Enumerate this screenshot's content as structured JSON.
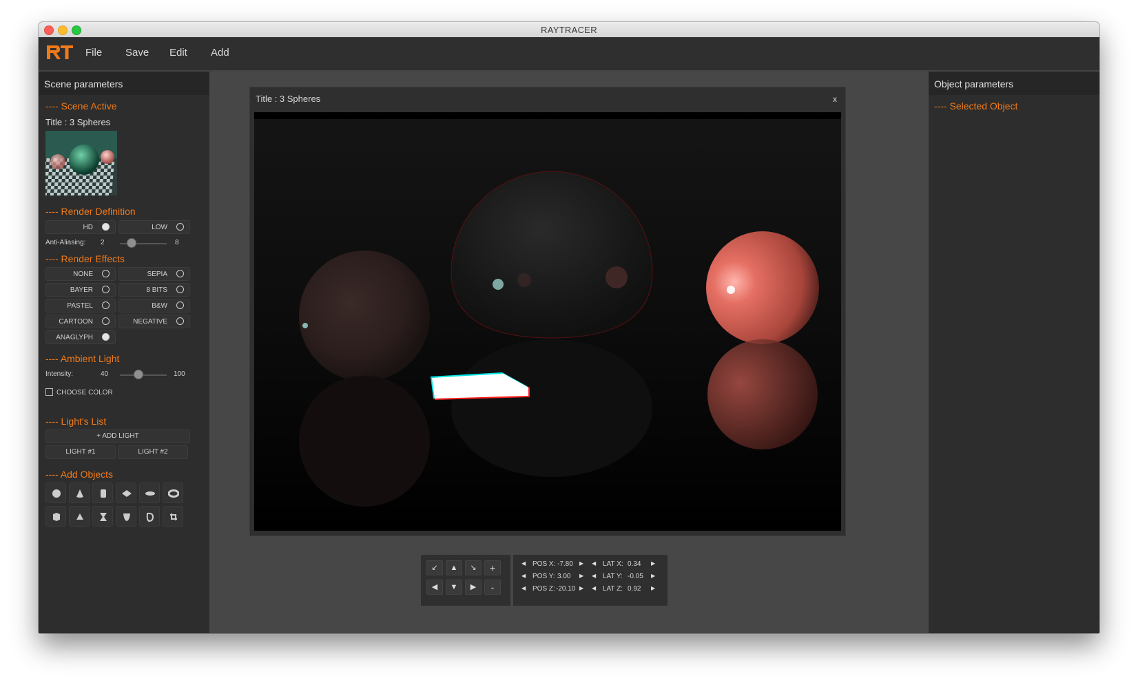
{
  "window": {
    "title": "RAYTRACER"
  },
  "menu": {
    "file": "File",
    "save": "Save",
    "edit": "Edit",
    "add": "Add"
  },
  "colors": {
    "accent": "#ef7a1a",
    "panel": "#2d2d2d",
    "background": "#474747"
  },
  "left_panel": {
    "header": "Scene parameters",
    "scene_active": {
      "heading": "---- Scene Active",
      "title": "Title : 3 Spheres"
    },
    "render_definition": {
      "heading": "---- Render Definition",
      "options": [
        {
          "label": "HD",
          "selected": true
        },
        {
          "label": "LOW",
          "selected": false
        }
      ],
      "anti_aliasing": {
        "label": "Anti-Aliasing:",
        "value": "2",
        "max": "8",
        "fraction": 0.25
      }
    },
    "render_effects": {
      "heading": "---- Render Effects",
      "options": [
        {
          "label": "NONE",
          "selected": false
        },
        {
          "label": "SEPIA",
          "selected": false
        },
        {
          "label": "BAYER",
          "selected": false
        },
        {
          "label": "8 BITS",
          "selected": false
        },
        {
          "label": "PASTEL",
          "selected": false
        },
        {
          "label": "B&W",
          "selected": false
        },
        {
          "label": "CARTOON",
          "selected": false
        },
        {
          "label": "NEGATIVE",
          "selected": false
        },
        {
          "label": "ANAGLYPH",
          "selected": true
        }
      ]
    },
    "ambient_light": {
      "heading": "---- Ambient Light",
      "intensity_label": "Intensity:",
      "value": "40",
      "max": "100",
      "fraction": 0.4,
      "choose_color": "CHOOSE COLOR"
    },
    "lights": {
      "heading": "---- Light's List",
      "add_label": "+ ADD LIGHT",
      "items": [
        "LIGHT #1",
        "LIGHT #2"
      ]
    },
    "add_objects": {
      "heading": "---- Add Objects",
      "icons": [
        "sphere-icon",
        "cone-icon",
        "cylinder-icon",
        "plane-icon",
        "disc-icon",
        "torus-icon",
        "cube-icon",
        "pyramid-icon",
        "hourboloid-icon",
        "paraboloid-icon",
        "mobius-icon",
        "composite-icon"
      ]
    }
  },
  "right_panel": {
    "header": "Object parameters",
    "selected_heading": "---- Selected Object"
  },
  "render_window": {
    "title": "Title : 3 Spheres",
    "close": "x"
  },
  "navigation": {
    "plus": "+",
    "minus": "-"
  },
  "camera": {
    "pos_x": {
      "label": "POS X:",
      "value": "-7.80"
    },
    "pos_y": {
      "label": "POS Y:",
      "value": "3.00"
    },
    "pos_z": {
      "label": "POS Z:",
      "value": "-20.10"
    },
    "lat_x": {
      "label": "LAT X:",
      "value": "0.34"
    },
    "lat_y": {
      "label": "LAT Y:",
      "value": "-0.05"
    },
    "lat_z": {
      "label": "LAT Z:",
      "value": "0.92"
    }
  }
}
